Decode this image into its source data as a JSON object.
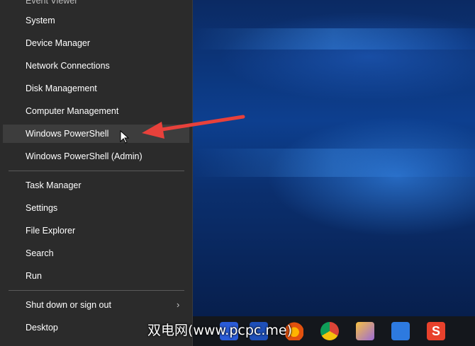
{
  "menu": {
    "partial_top": "Event Viewer",
    "items": [
      {
        "label": "System"
      },
      {
        "label": "Device Manager"
      },
      {
        "label": "Network Connections"
      },
      {
        "label": "Disk Management"
      },
      {
        "label": "Computer Management"
      },
      {
        "label": "Windows PowerShell"
      },
      {
        "label": "Windows PowerShell (Admin)"
      },
      {
        "label": "Task Manager"
      },
      {
        "label": "Settings"
      },
      {
        "label": "File Explorer"
      },
      {
        "label": "Search"
      },
      {
        "label": "Run"
      },
      {
        "label": "Shut down or sign out"
      },
      {
        "label": "Desktop"
      }
    ]
  },
  "watermark": "双电网(www.pcpc.me)",
  "colors": {
    "menu_bg": "#2b2b2b",
    "hover_bg": "#3d3d3d",
    "arrow": "#e8413b"
  }
}
